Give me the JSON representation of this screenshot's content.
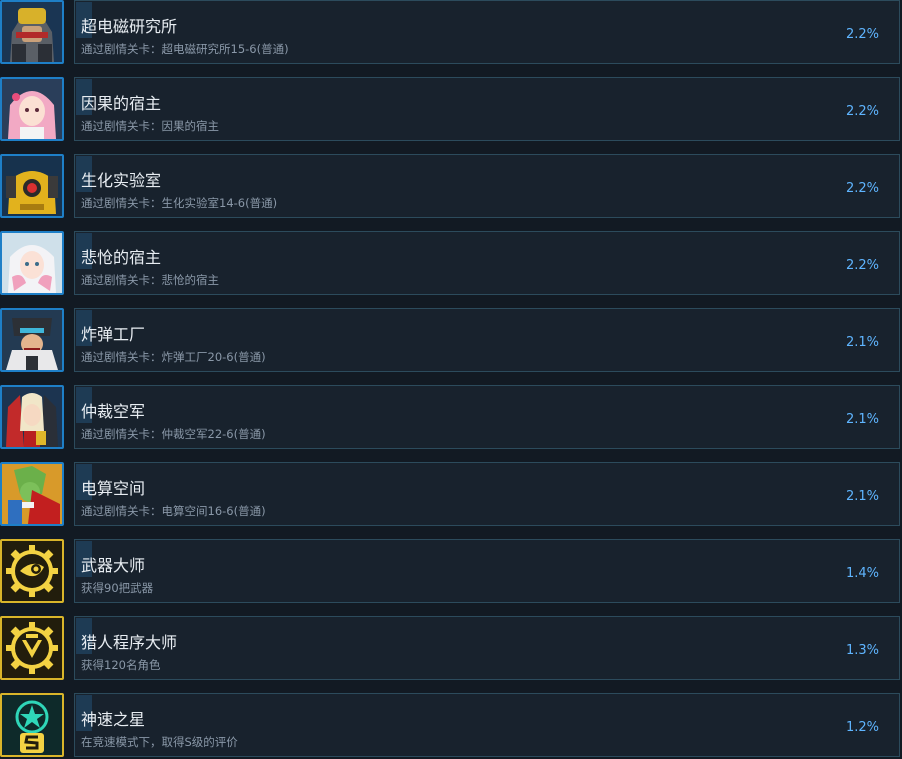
{
  "achievements": [
    {
      "title": "超电磁研究所",
      "description": "通过剧情关卡：超电磁研究所15-6(普通)",
      "percent": "2.2%",
      "icon": "robot-boss-portrait-icon"
    },
    {
      "title": "因果的宿主",
      "description": "通过剧情关卡：因果的宿主",
      "percent": "2.2%",
      "icon": "pink-hair-girl-portrait-icon"
    },
    {
      "title": "生化实验室",
      "description": "通过剧情关卡：生化实验室14-6(普通)",
      "percent": "2.2%",
      "icon": "yellow-robot-portrait-icon"
    },
    {
      "title": "悲怆的宿主",
      "description": "通过剧情关卡：悲怆的宿主",
      "percent": "2.2%",
      "icon": "white-hair-girl-portrait-icon"
    },
    {
      "title": "炸弹工厂",
      "description": "通过剧情关卡：炸弹工厂20-6(普通)",
      "percent": "2.1%",
      "icon": "bomber-robot-portrait-icon"
    },
    {
      "title": "仲裁空军",
      "description": "通过剧情关卡：仲裁空军22-6(普通)",
      "percent": "2.1%",
      "icon": "red-air-force-portrait-icon"
    },
    {
      "title": "电算空间",
      "description": "通过剧情关卡：电算空间16-6(普通)",
      "percent": "2.1%",
      "icon": "green-mage-portrait-icon"
    },
    {
      "title": "武器大师",
      "description": "获得90把武器",
      "percent": "1.4%",
      "icon": "gold-gear-weapon-icon"
    },
    {
      "title": "猎人程序大师",
      "description": "获得120名角色",
      "percent": "1.3%",
      "icon": "gold-gear-hunter-icon"
    },
    {
      "title": "神速之星",
      "description": "在竞速模式下，取得S级的评价",
      "percent": "1.2%",
      "icon": "s-rank-star-icon"
    }
  ],
  "colors": {
    "background": "#121a23",
    "percent": "#5fb5ff",
    "title": "#e8edf2",
    "description": "#8a98a8",
    "blue_frame": "#1e7fc7",
    "gold_frame": "#d9b52a"
  }
}
